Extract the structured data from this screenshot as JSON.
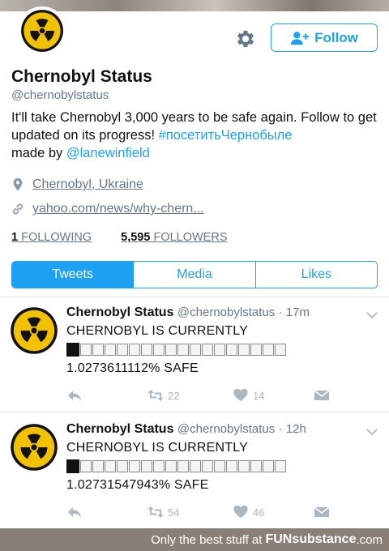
{
  "profile": {
    "name": "Chernobyl Status",
    "handle": "@chernobylstatus",
    "bio_text": "It'll take Chernobyl 3,000 years to be safe again. Follow to get updated on its progress! ",
    "bio_hashtag": "#посетитьЧернобыле",
    "bio_made_by": "made by ",
    "bio_mention": "@lanewinfield",
    "location": "Chernobyl, Ukraine",
    "website": "yahoo.com/news/why-chern...",
    "following_count": "1",
    "following_label": "FOLLOWING",
    "followers_count": "5,595",
    "followers_label": "FOLLOWERS"
  },
  "header": {
    "follow_label": "Follow",
    "settings_icon": "gear-icon",
    "follow_icon": "add-user-icon"
  },
  "tabs": [
    {
      "label": "Tweets",
      "active": true
    },
    {
      "label": "Media",
      "active": false
    },
    {
      "label": "Likes",
      "active": false
    }
  ],
  "tweets": [
    {
      "name": "Chernobyl Status",
      "handle": "@chernobylstatus",
      "time": "· 17m",
      "line1": "CHERNOBYL IS CURRENTLY",
      "progress_filled_cells": 1,
      "progress_total_cells": 18,
      "line2": "1.0273611112% SAFE",
      "retweets": "22",
      "likes": "14"
    },
    {
      "name": "Chernobyl Status",
      "handle": "@chernobylstatus",
      "time": "· 12h",
      "line1": "CHERNOBYL IS CURRENTLY",
      "progress_filled_cells": 1,
      "progress_total_cells": 18,
      "line2": "1.02731547943% SAFE",
      "retweets": "54",
      "likes": "46"
    }
  ],
  "footer": {
    "text": "Only the best stuff at",
    "brand": "FUNsubstance",
    "suffix": ".com"
  },
  "colors": {
    "accent": "#1da1f2",
    "muted": "#657786",
    "radiation_yellow": "#f2c200"
  }
}
